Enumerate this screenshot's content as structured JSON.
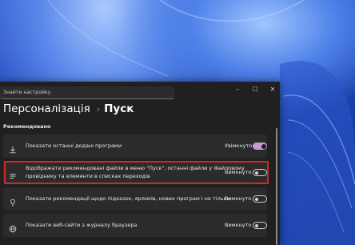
{
  "window": {
    "search_placeholder": "Знайти настройку",
    "controls": {
      "minimize": "–",
      "maximize": "☐",
      "close": "✕"
    }
  },
  "breadcrumb": {
    "parent": "Персоналізація",
    "separator": "›",
    "current": "Пуск"
  },
  "section_title": "Рекомендовано",
  "settings": [
    {
      "icon": "download-icon",
      "label": "Показати останні додані програми",
      "state": "Увімкнуто",
      "toggle": "on"
    },
    {
      "icon": "list-icon",
      "label_line1": "Відображати рекомендовані файли в меню \"Пуск\", останні файли у Файловому",
      "label_line2": "провіднику та елементи в списках переходів",
      "state": "Вимкнуто",
      "toggle": "off"
    },
    {
      "icon": "lightbulb-icon",
      "label": "Показати рекомендації щодо підказок, ярликів, нових програм і не тільки.",
      "state": "Вимкнуто",
      "toggle": "off"
    },
    {
      "icon": "globe-icon",
      "label": "Показати веб-сайти з журналу браузера",
      "state": "Вимкнуто",
      "toggle": "off"
    }
  ]
}
